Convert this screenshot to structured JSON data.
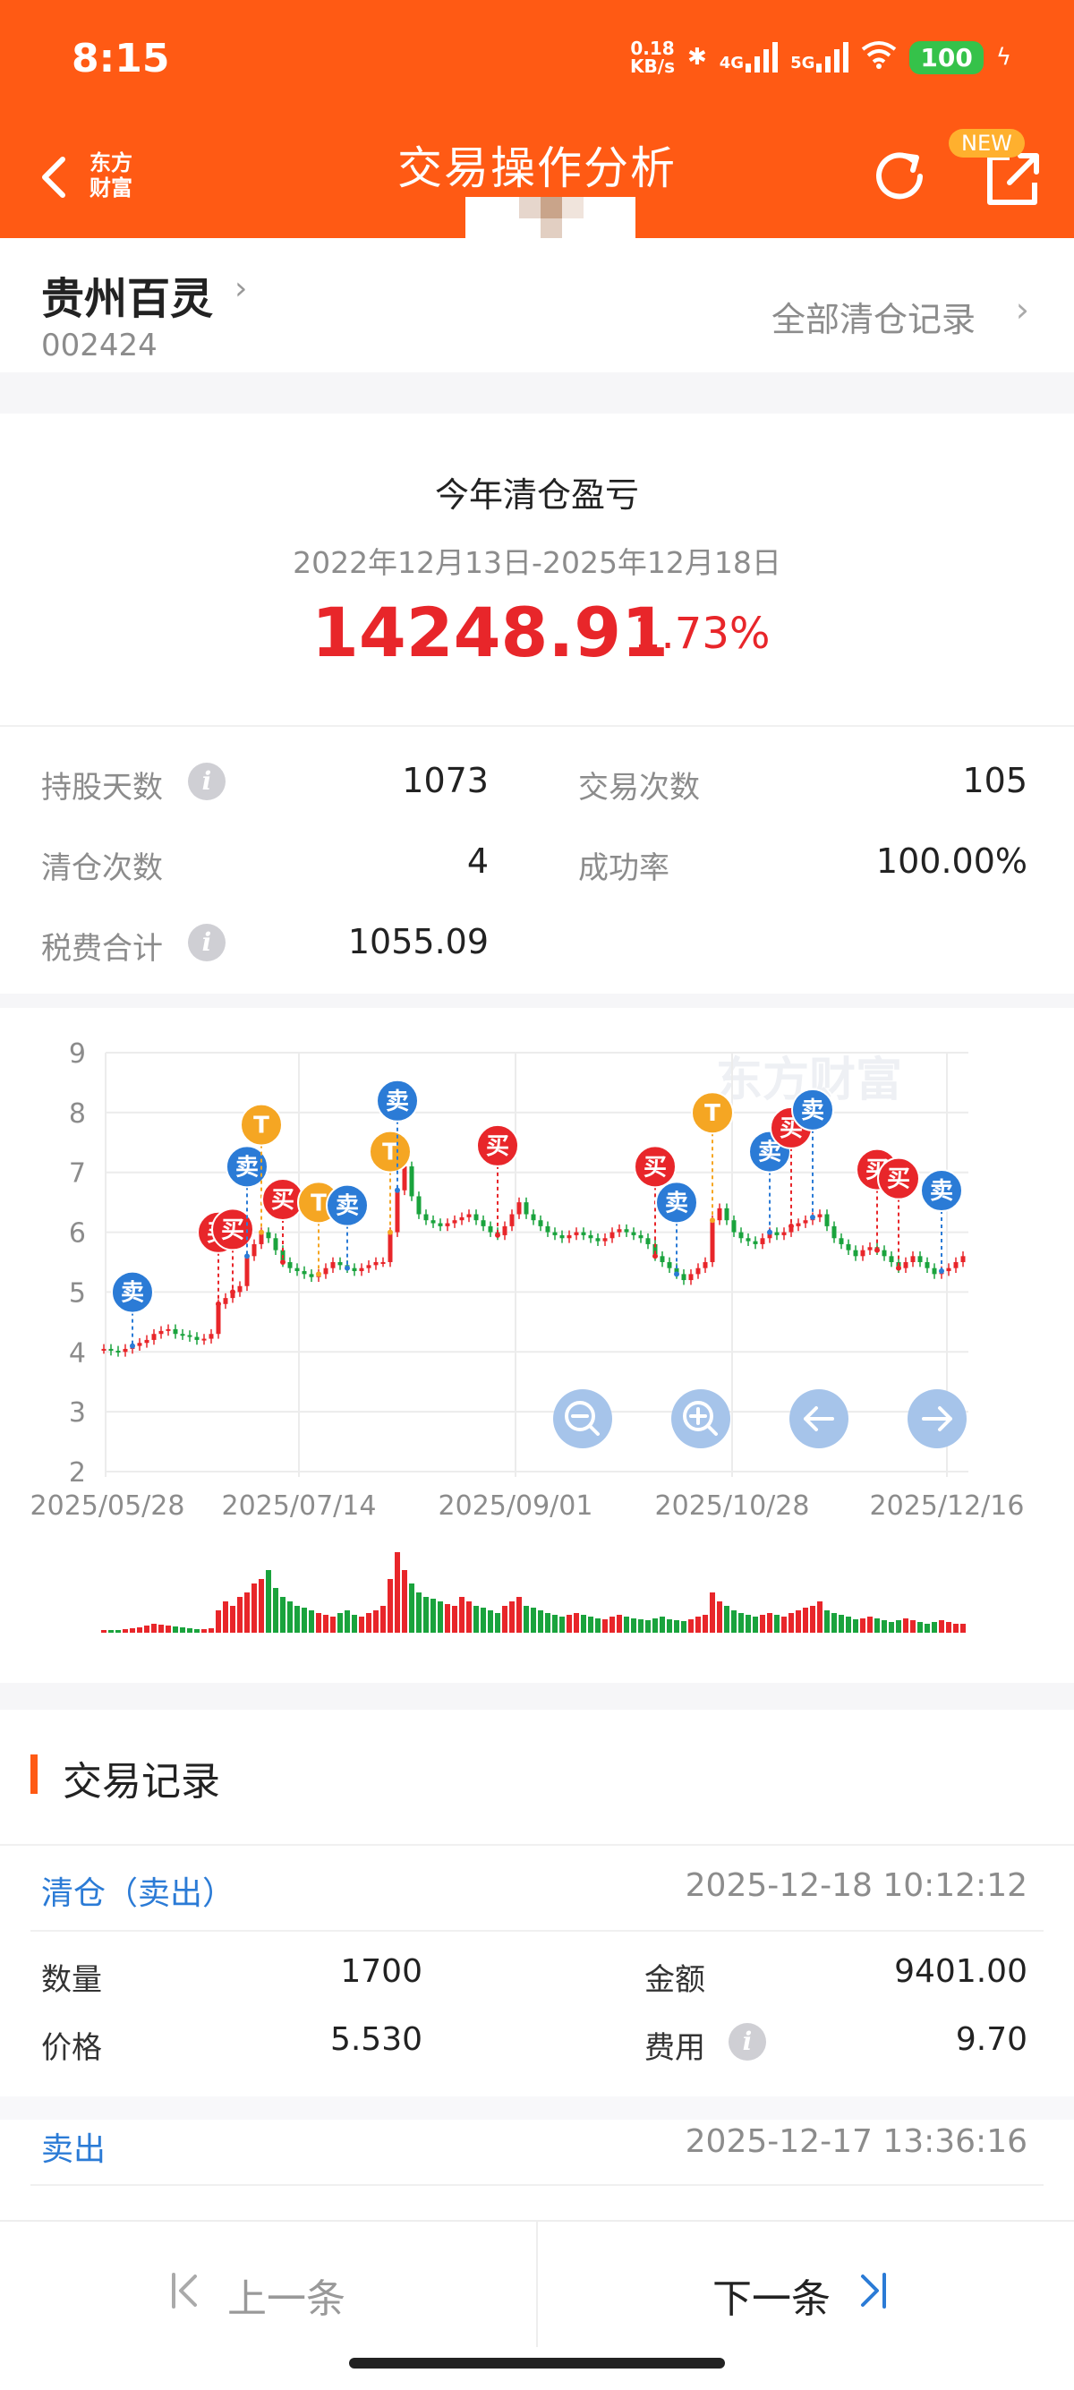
{
  "status": {
    "time": "8:15",
    "net_speed_top": "0.18",
    "net_speed_bottom": "KB/s",
    "net1": "4G",
    "net2": "5G",
    "battery": "100"
  },
  "header": {
    "title": "交易操作分析",
    "brand_line1": "东方",
    "brand_line2": "财富",
    "new_badge": "NEW"
  },
  "stock": {
    "name": "贵州百灵",
    "code": "002424",
    "clear_all": "全部清仓记录"
  },
  "summary": {
    "title": "今年清仓盈亏",
    "range": "2022年12月13日-2025年12月18日",
    "profit": "14248.91",
    "percent": "1.73%",
    "stats": [
      {
        "label": "持股天数",
        "value": "1073"
      },
      {
        "label": "交易次数",
        "value": "105"
      },
      {
        "label": "清仓次数",
        "value": "4"
      },
      {
        "label": "成功率",
        "value": "100.00%"
      },
      {
        "label": "税费合计",
        "value": "1055.09"
      }
    ]
  },
  "chart_data": {
    "type": "candlestick",
    "watermark": "东方财富",
    "y_ticks": [
      "9",
      "8",
      "7",
      "6",
      "5",
      "4",
      "3",
      "2"
    ],
    "ylim": [
      2,
      9
    ],
    "x_ticks": [
      "2025/05/28",
      "2025/07/14",
      "2025/09/01",
      "2025/10/28",
      "2025/12/16"
    ],
    "price_path": [
      4.05,
      4.02,
      4.0,
      4.05,
      4.1,
      4.15,
      4.2,
      4.3,
      4.35,
      4.38,
      4.3,
      4.28,
      4.25,
      4.2,
      4.22,
      4.3,
      4.8,
      4.9,
      5.0,
      5.1,
      5.6,
      5.8,
      6.0,
      5.9,
      5.7,
      5.5,
      5.4,
      5.35,
      5.3,
      5.25,
      5.3,
      5.4,
      5.5,
      5.45,
      5.4,
      5.35,
      5.4,
      5.45,
      5.5,
      5.5,
      6.0,
      6.7,
      7.1,
      6.6,
      6.3,
      6.2,
      6.15,
      6.1,
      6.15,
      6.2,
      6.25,
      6.3,
      6.2,
      6.1,
      6.0,
      5.95,
      6.1,
      6.3,
      6.5,
      6.3,
      6.2,
      6.1,
      6.0,
      5.95,
      5.9,
      5.95,
      6.0,
      5.95,
      5.9,
      5.85,
      5.9,
      6.0,
      6.05,
      6.0,
      5.95,
      5.9,
      5.8,
      5.6,
      5.5,
      5.4,
      5.3,
      5.2,
      5.3,
      5.4,
      5.5,
      6.2,
      6.4,
      6.2,
      6.0,
      5.9,
      5.85,
      5.8,
      5.9,
      6.0,
      5.95,
      6.0,
      6.1,
      6.15,
      6.2,
      6.25,
      6.3,
      6.1,
      5.9,
      5.8,
      5.7,
      5.6,
      5.7,
      5.75,
      5.7,
      5.6,
      5.5,
      5.4,
      5.5,
      5.6,
      5.5,
      5.4,
      5.3,
      5.35,
      5.4,
      5.5,
      5.6
    ],
    "volume": [
      3,
      3,
      3,
      4,
      5,
      6,
      8,
      10,
      9,
      8,
      7,
      6,
      5,
      4,
      4,
      5,
      25,
      35,
      30,
      40,
      45,
      55,
      60,
      70,
      50,
      40,
      35,
      30,
      28,
      25,
      22,
      20,
      18,
      22,
      25,
      20,
      18,
      22,
      25,
      30,
      60,
      90,
      70,
      55,
      45,
      40,
      38,
      35,
      32,
      30,
      40,
      35,
      30,
      28,
      25,
      22,
      30,
      35,
      40,
      30,
      28,
      25,
      22,
      20,
      18,
      20,
      22,
      20,
      18,
      16,
      15,
      18,
      20,
      18,
      16,
      15,
      14,
      16,
      18,
      15,
      14,
      13,
      15,
      18,
      20,
      45,
      35,
      30,
      25,
      22,
      20,
      18,
      20,
      22,
      20,
      18,
      22,
      25,
      28,
      30,
      35,
      25,
      22,
      20,
      18,
      15,
      16,
      18,
      16,
      14,
      12,
      14,
      16,
      14,
      12,
      10,
      12,
      14,
      12,
      10,
      10
    ],
    "markers": [
      {
        "label": "卖",
        "type": "sell"
      },
      {
        "label": "买",
        "type": "buy"
      },
      {
        "label": "买",
        "type": "buy"
      },
      {
        "label": "卖",
        "type": "sell"
      },
      {
        "label": "T",
        "type": "t"
      },
      {
        "label": "买",
        "type": "buy"
      },
      {
        "label": "T",
        "type": "t"
      },
      {
        "label": "卖",
        "type": "sell"
      },
      {
        "label": "T",
        "type": "t"
      },
      {
        "label": "卖",
        "type": "sell"
      },
      {
        "label": "买",
        "type": "buy"
      },
      {
        "label": "买",
        "type": "buy"
      },
      {
        "label": "卖",
        "type": "sell"
      },
      {
        "label": "T",
        "type": "t"
      },
      {
        "label": "卖",
        "type": "sell"
      },
      {
        "label": "买",
        "type": "buy"
      },
      {
        "label": "卖",
        "type": "sell"
      },
      {
        "label": "买",
        "type": "buy"
      },
      {
        "label": "买",
        "type": "buy"
      },
      {
        "label": "卖",
        "type": "sell"
      }
    ],
    "colors": {
      "up": "#e8262a",
      "down": "#1aa33d",
      "buy": "#e8262a",
      "sell": "#2b7bd6",
      "t": "#f5a623"
    }
  },
  "records": {
    "title": "交易记录",
    "items": [
      {
        "type": "清仓（卖出）",
        "time": "2025-12-18 10:12:12",
        "qty_label": "数量",
        "qty": "1700",
        "amt_label": "金额",
        "amt": "9401.00",
        "price_label": "价格",
        "price": "5.530",
        "fee_label": "费用",
        "fee": "9.70"
      },
      {
        "type": "卖出",
        "time": "2025-12-17 13:36:16"
      }
    ]
  },
  "nav": {
    "prev": "上一条",
    "next": "下一条"
  }
}
